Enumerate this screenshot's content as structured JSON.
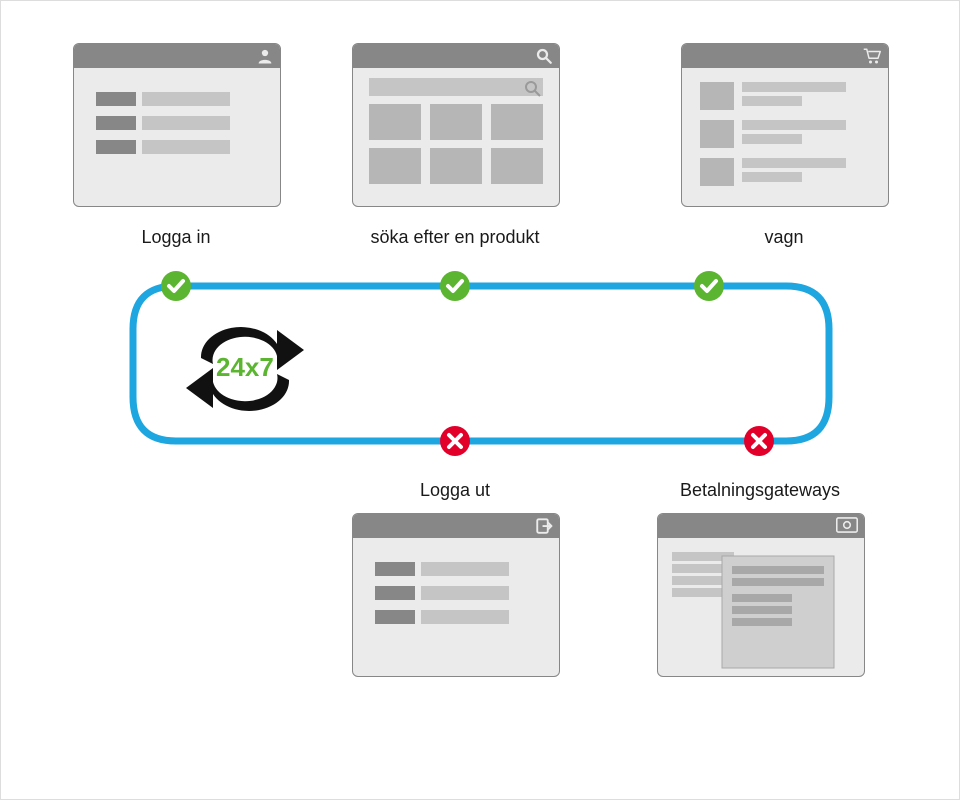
{
  "cycle_text": "24x7",
  "steps": {
    "login": {
      "label": "Logga in",
      "status": "pass",
      "icon": "user"
    },
    "search": {
      "label": "söka efter en produkt",
      "status": "pass",
      "icon": "search"
    },
    "cart": {
      "label": "vagn",
      "status": "pass",
      "icon": "cart"
    },
    "payment": {
      "label": "Betalningsgateways",
      "status": "fail",
      "icon": "money"
    },
    "logout": {
      "label": "Logga ut",
      "status": "fail",
      "icon": "logout"
    }
  },
  "colors": {
    "pass": "#5cb531",
    "fail": "#e2002b",
    "flow": "#1da6e0",
    "window_border": "#878787",
    "window_bg": "#ebebeb",
    "chrome": "#878787",
    "placeholder_dark": "#878787",
    "placeholder_light": "#c5c5c5"
  }
}
